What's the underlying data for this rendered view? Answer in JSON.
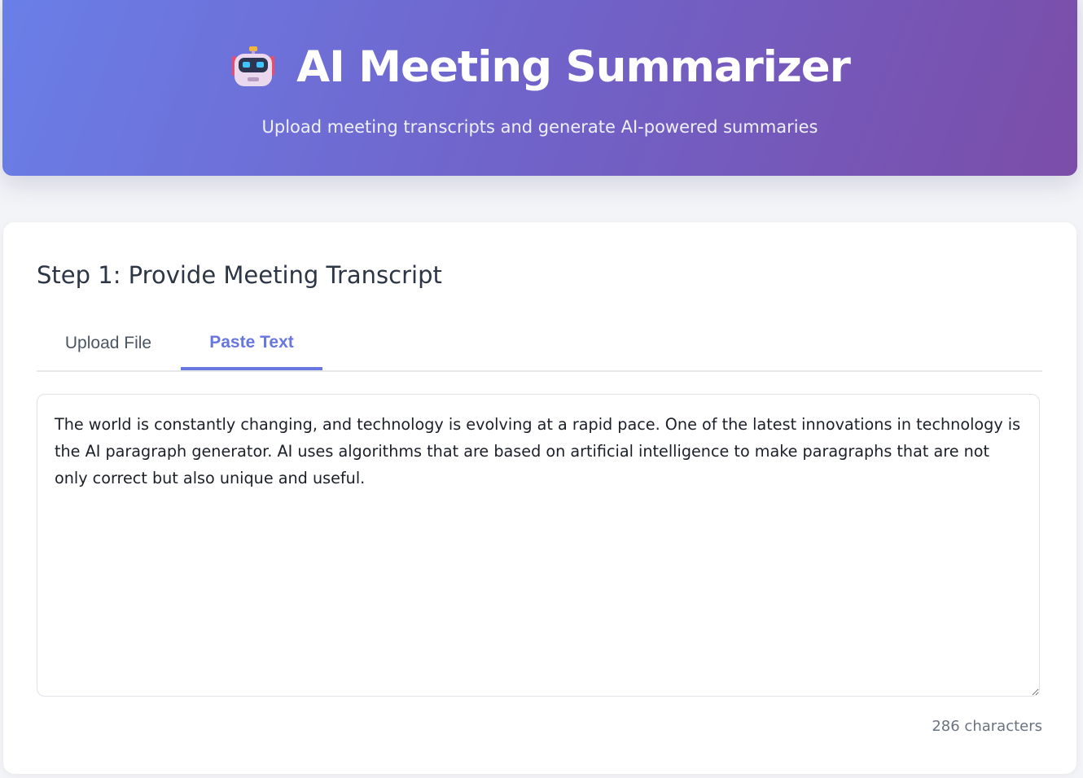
{
  "header": {
    "icon": "robot-icon",
    "title": "AI Meeting Summarizer",
    "subtitle": "Upload meeting transcripts and generate AI-powered summaries"
  },
  "step1": {
    "heading": "Step 1: Provide Meeting Transcript",
    "tabs": [
      {
        "label": "Upload File",
        "active": false
      },
      {
        "label": "Paste Text",
        "active": true
      }
    ],
    "transcript_value": "The world is constantly changing, and technology is evolving at a rapid pace. One of the latest innovations in technology is the AI paragraph generator. AI uses algorithms that are based on artificial intelligence to make paragraphs that are not only correct but also unique and useful.",
    "char_count": "286 characters"
  },
  "colors": {
    "header_gradient_start": "#6a7fe8",
    "header_gradient_end": "#7b4da8",
    "accent": "#6877df",
    "page_background": "#f3f4f7"
  }
}
